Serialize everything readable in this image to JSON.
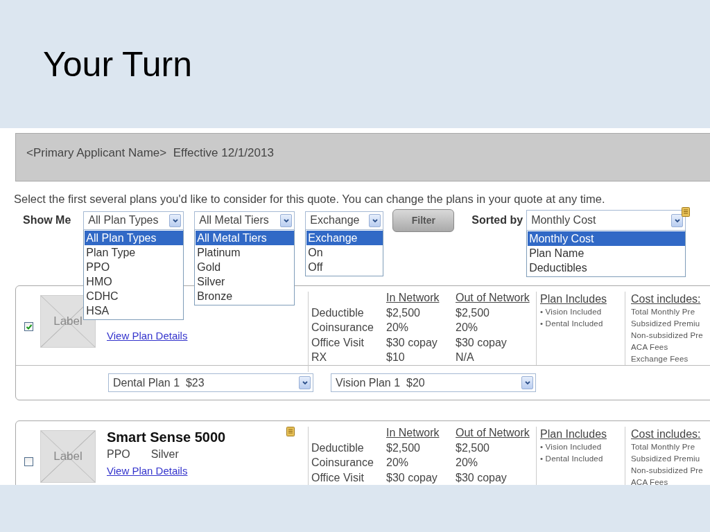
{
  "slide": {
    "title": "Your Turn"
  },
  "header": {
    "text": "<Primary Applicant Name>  Effective 12/1/2013"
  },
  "instruction": "Select the first several plans you'd like to consider for this quote. You can change the plans in your quote at any time.",
  "filters": {
    "label": "Show Me",
    "button": "Filter",
    "sort_label": "Sorted by",
    "dropdowns": [
      {
        "value": "All Plan Types",
        "options": [
          {
            "label": "All Plan Types",
            "selected": true
          },
          {
            "label": "Plan Type",
            "selected": false
          },
          {
            "label": "PPO",
            "selected": false
          },
          {
            "label": "HMO",
            "selected": false
          },
          {
            "label": "CDHC",
            "selected": false
          },
          {
            "label": "HSA",
            "selected": false
          }
        ]
      },
      {
        "value": "All Metal Tiers",
        "options": [
          {
            "label": "All Metal Tiers",
            "selected": true
          },
          {
            "label": "Platinum",
            "selected": false
          },
          {
            "label": "Gold",
            "selected": false
          },
          {
            "label": "Silver",
            "selected": false
          },
          {
            "label": "Bronze",
            "selected": false
          }
        ]
      },
      {
        "value": "Exchange",
        "options": [
          {
            "label": "Exchange",
            "selected": true
          },
          {
            "label": "On",
            "selected": false
          },
          {
            "label": "Off",
            "selected": false
          }
        ]
      }
    ],
    "sort": {
      "value": "Monthly Cost",
      "options": [
        {
          "label": "Monthly Cost",
          "selected": true
        },
        {
          "label": "Plan Name",
          "selected": false
        },
        {
          "label": "Deductibles",
          "selected": false
        }
      ]
    }
  },
  "plans": [
    {
      "checked": true,
      "has_note": false,
      "image_label": "Label",
      "link": "View Plan Details",
      "columns": [
        "In Network",
        "Out of Network"
      ],
      "rows": [
        {
          "label": "Deductible",
          "in_network": "$2,500",
          "out_network": "$2,500"
        },
        {
          "label": "Coinsurance",
          "in_network": "20%",
          "out_network": "20%"
        },
        {
          "label": "Office Visit",
          "in_network": "$30 copay",
          "out_network": "$30 copay"
        },
        {
          "label": "RX",
          "in_network": "$10",
          "out_network": "N/A"
        }
      ],
      "includes_title": "Plan Includes",
      "includes": [
        "• Vision Included",
        "• Dental Included"
      ],
      "cost_title": "Cost includes:",
      "cost_items": [
        "Total Monthly Pre",
        "Subsidized Premiu",
        "Non-subsidized Pre",
        "ACA Fees",
        "Exchange Fees"
      ],
      "addons": [
        "Dental Plan 1  $23",
        "Vision Plan 1  $20"
      ]
    },
    {
      "checked": false,
      "has_note": true,
      "name": "Smart Sense 5000",
      "type": "PPO",
      "tier": "Silver",
      "image_label": "Label",
      "link": "View Plan Details",
      "columns": [
        "In Network",
        "Out of Network"
      ],
      "rows": [
        {
          "label": "Deductible",
          "in_network": "$2,500",
          "out_network": "$2,500"
        },
        {
          "label": "Coinsurance",
          "in_network": "20%",
          "out_network": "20%"
        },
        {
          "label": "Office Visit",
          "in_network": "$30 copay",
          "out_network": "$30 copay"
        }
      ],
      "includes_title": "Plan Includes",
      "includes": [
        "• Vision Included",
        "• Dental Included"
      ],
      "cost_title": "Cost includes:",
      "cost_items": [
        "Total Monthly Pre",
        "Subsidized Premiu",
        "Non-subsidized Pre",
        "ACA Fees"
      ]
    }
  ]
}
